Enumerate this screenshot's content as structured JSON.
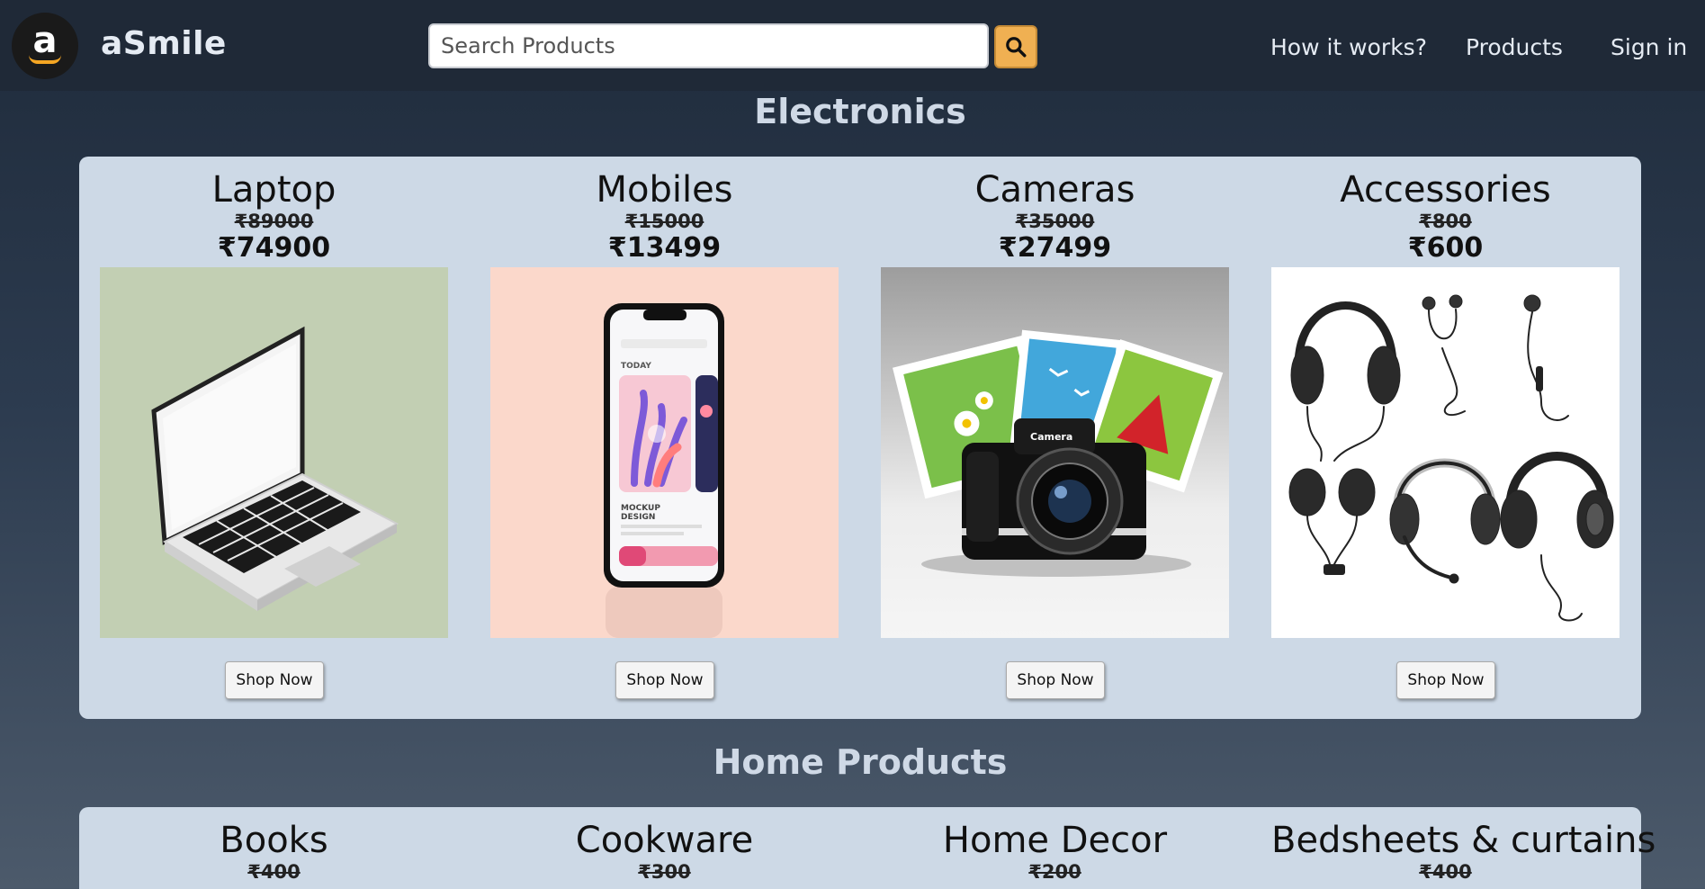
{
  "header": {
    "logo_letter": "a",
    "brand": "aSmile",
    "search_placeholder": "Search Products",
    "nav": [
      "How it works?",
      "Products",
      "Sign in"
    ]
  },
  "sections": [
    {
      "title": "Electronics",
      "products": [
        {
          "name": "Laptop",
          "old_price": "₹89000",
          "price": "₹74900",
          "button": "Shop Now",
          "image": "laptop-image"
        },
        {
          "name": "Mobiles",
          "old_price": "₹15000",
          "price": "₹13499",
          "button": "Shop Now",
          "image": "mobile-image"
        },
        {
          "name": "Cameras",
          "old_price": "₹35000",
          "price": "₹27499",
          "button": "Shop Now",
          "image": "camera-image"
        },
        {
          "name": "Accessories",
          "old_price": "₹800",
          "price": "₹600",
          "button": "Shop Now",
          "image": "headphones-image"
        }
      ]
    },
    {
      "title": "Home Products",
      "products": [
        {
          "name": "Books",
          "old_price": "₹400"
        },
        {
          "name": "Cookware",
          "old_price": "₹300"
        },
        {
          "name": "Home Decor",
          "old_price": "₹200"
        },
        {
          "name": "Bedsheets & curtains",
          "old_price": "₹400"
        }
      ]
    }
  ],
  "mockup_text": {
    "today": "TODAY",
    "mockup": "MOCKUP",
    "design": "DESIGN"
  },
  "camera_text": "Camera",
  "colors": {
    "header_bg": "#1f2937",
    "panel_bg": "#cdd9e6",
    "search_button": "#f0b052"
  }
}
